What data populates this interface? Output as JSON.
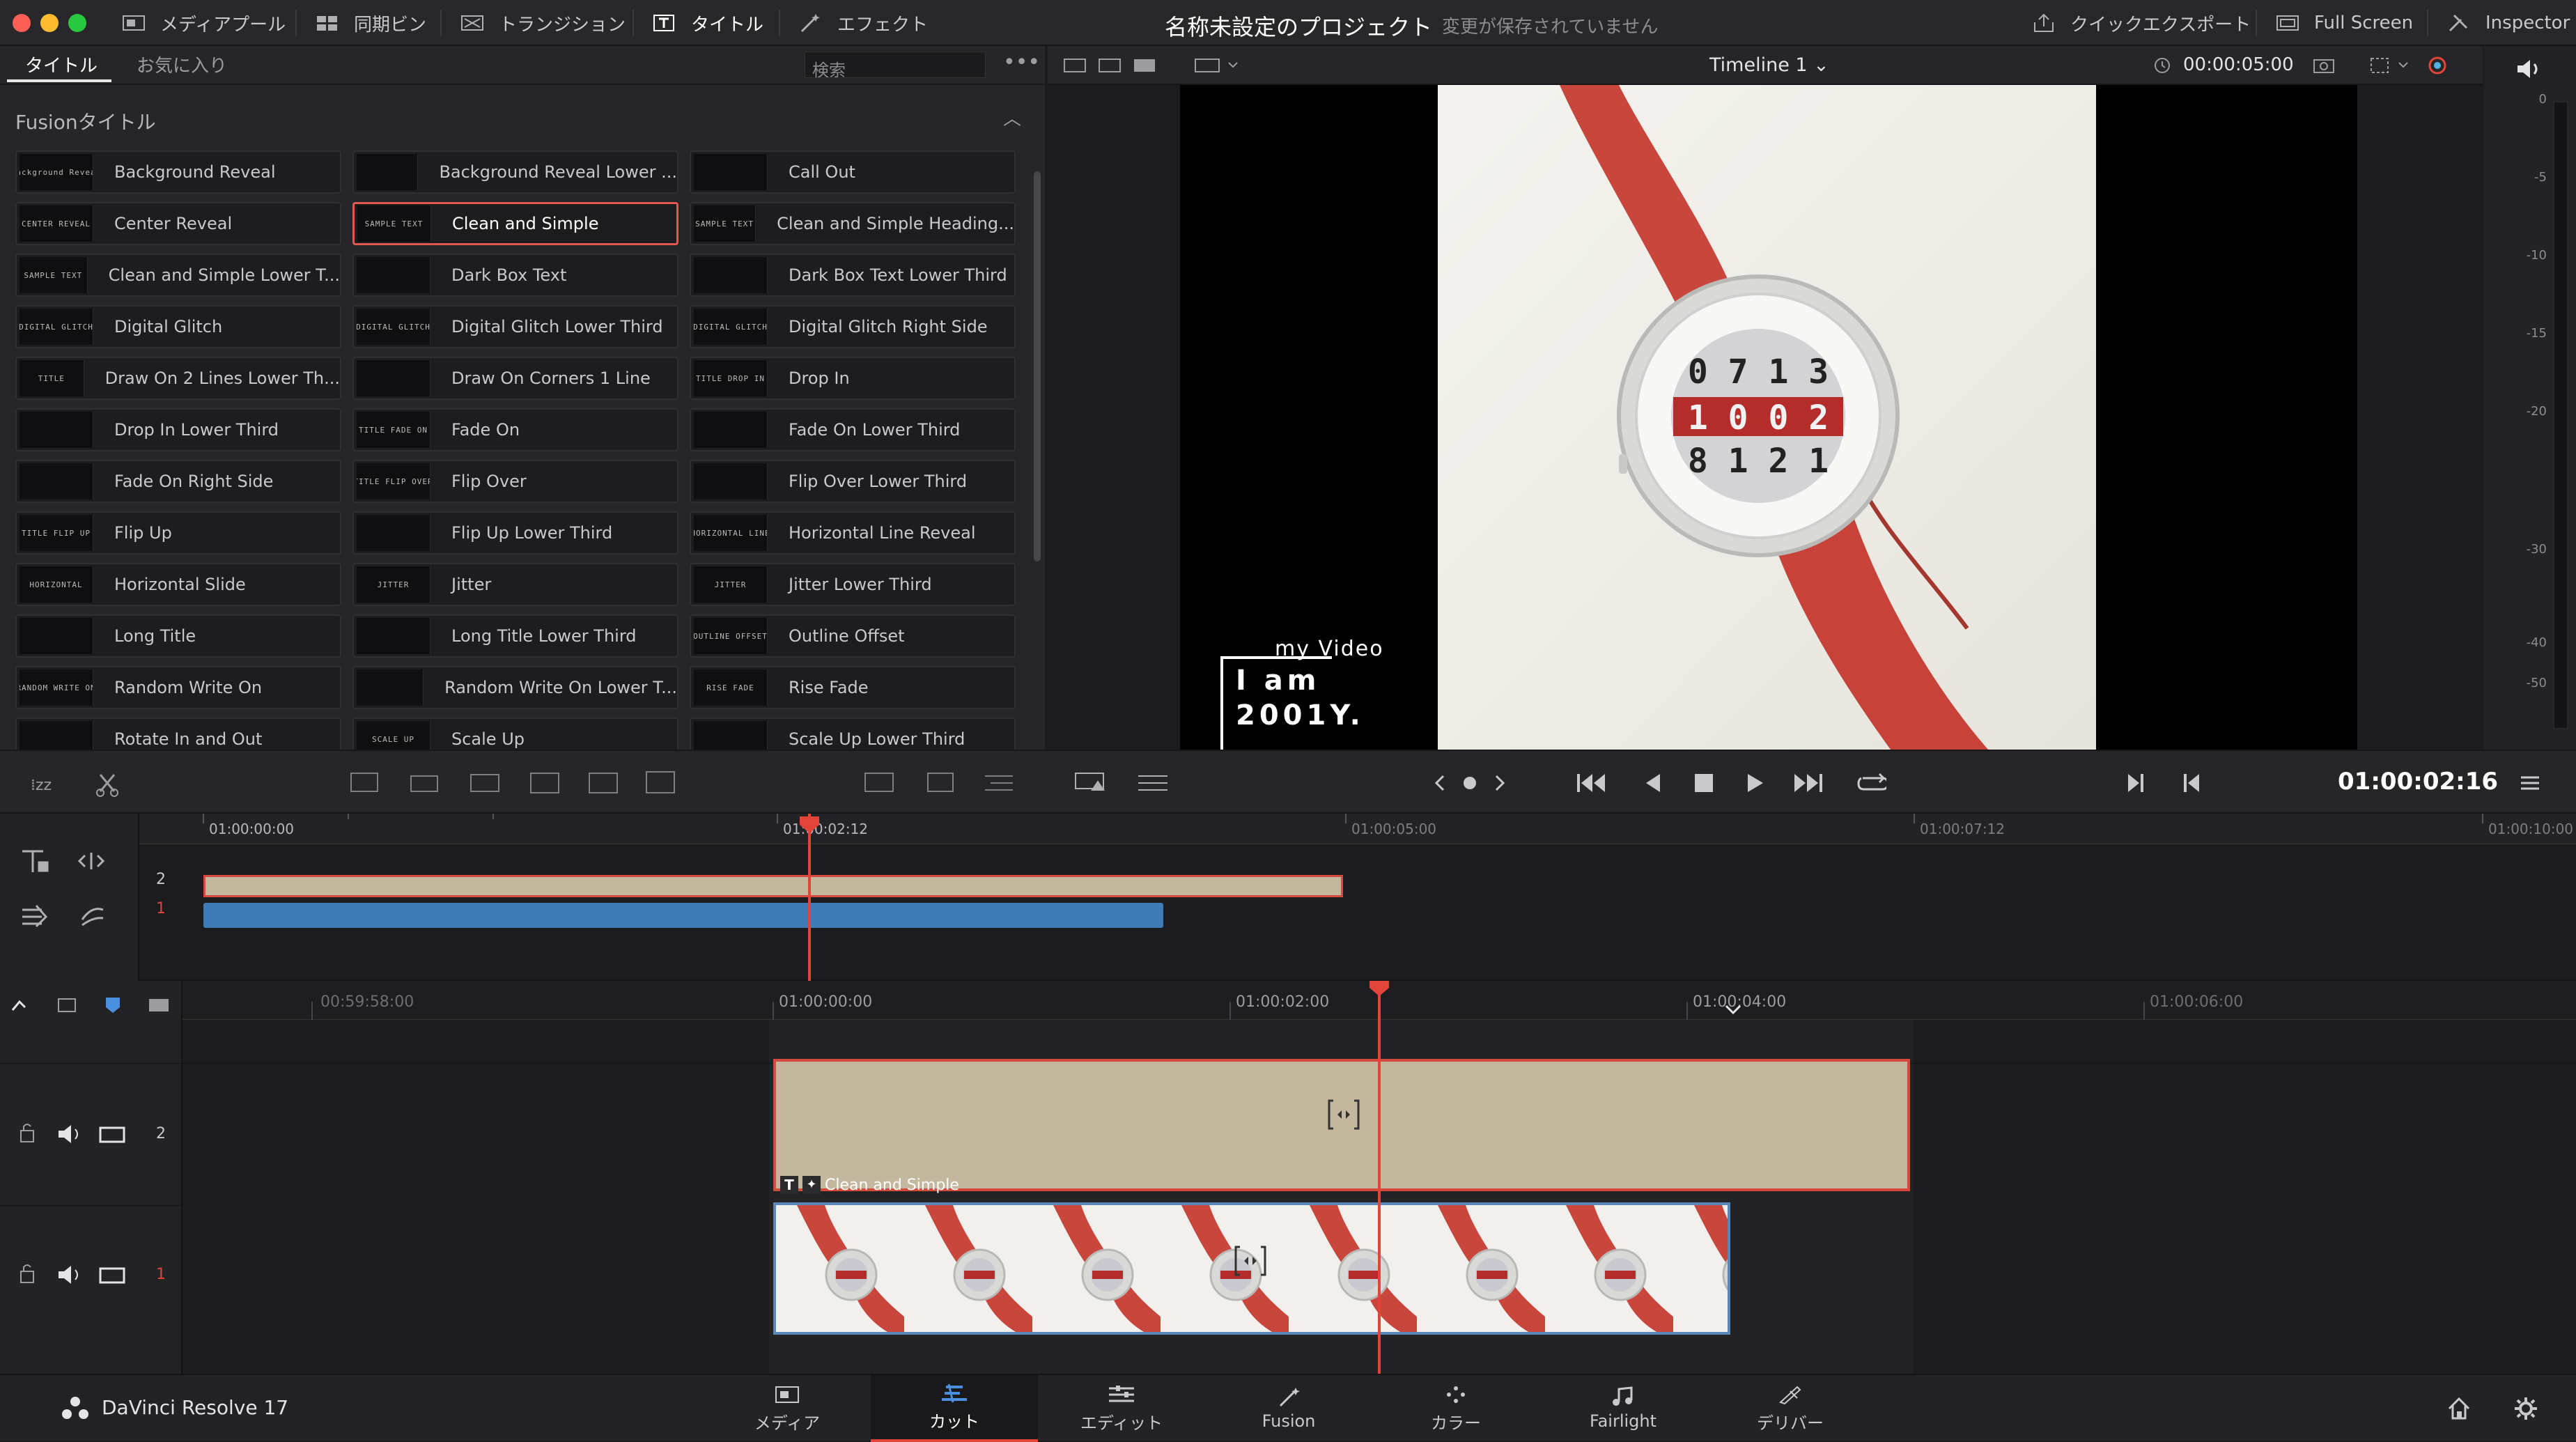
{
  "window": {
    "project_title": "名称未設定のプロジェクト",
    "save_status": "変更が保存されていません"
  },
  "toolbar": {
    "media_pool": "メディアプール",
    "sync_bin": "同期ビン",
    "transitions": "トランジション",
    "titles": "タイトル",
    "effects": "エフェクト",
    "quick_export": "クイックエクスポート",
    "full_screen": "Full Screen",
    "inspector": "Inspector"
  },
  "left_panel": {
    "tab_titles": "タイトル",
    "tab_favorites": "お気に入り",
    "search_placeholder": "検索",
    "section_header": "Fusionタイトル",
    "titles": [
      {
        "label": "Background Reveal",
        "thumb": "Background Reveal"
      },
      {
        "label": "Background Reveal Lower ...",
        "thumb": ""
      },
      {
        "label": "Call Out",
        "thumb": ""
      },
      {
        "label": "Center Reveal",
        "thumb": "CENTER REVEAL"
      },
      {
        "label": "Clean and Simple",
        "thumb": "SAMPLE TEXT",
        "selected": true
      },
      {
        "label": "Clean and Simple Heading...",
        "thumb": "SAMPLE TEXT"
      },
      {
        "label": "Clean and Simple Lower T...",
        "thumb": "SAMPLE TEXT"
      },
      {
        "label": "Dark Box Text",
        "thumb": ""
      },
      {
        "label": "Dark Box Text Lower Third",
        "thumb": ""
      },
      {
        "label": "Digital Glitch",
        "thumb": "DIGITAL GLITCH"
      },
      {
        "label": "Digital Glitch Lower Third",
        "thumb": "DIGITAL GLITCH"
      },
      {
        "label": "Digital Glitch Right Side",
        "thumb": "DIGITAL GLITCH"
      },
      {
        "label": "Draw On 2 Lines Lower Th...",
        "thumb": "TITLE"
      },
      {
        "label": "Draw On Corners 1 Line",
        "thumb": ""
      },
      {
        "label": "Drop In",
        "thumb": "TITLE DROP IN"
      },
      {
        "label": "Drop In Lower Third",
        "thumb": ""
      },
      {
        "label": "Fade On",
        "thumb": "TITLE FADE ON"
      },
      {
        "label": "Fade On Lower Third",
        "thumb": ""
      },
      {
        "label": "Fade On Right Side",
        "thumb": ""
      },
      {
        "label": "Flip Over",
        "thumb": "TITLE FLIP OVER"
      },
      {
        "label": "Flip Over Lower Third",
        "thumb": ""
      },
      {
        "label": "Flip Up",
        "thumb": "TITLE FLIP UP"
      },
      {
        "label": "Flip Up Lower Third",
        "thumb": ""
      },
      {
        "label": "Horizontal Line Reveal",
        "thumb": "HORIZONTAL LINE"
      },
      {
        "label": "Horizontal Slide",
        "thumb": "HORIZONTAL"
      },
      {
        "label": "Jitter",
        "thumb": "JITTER"
      },
      {
        "label": "Jitter Lower Third",
        "thumb": "JITTER"
      },
      {
        "label": "Long Title",
        "thumb": ""
      },
      {
        "label": "Long Title Lower Third",
        "thumb": ""
      },
      {
        "label": "Outline Offset",
        "thumb": "OUTLINE OFFSET"
      },
      {
        "label": "Random Write On",
        "thumb": "RANDOM WRITE ON"
      },
      {
        "label": "Random Write On Lower T...",
        "thumb": ""
      },
      {
        "label": "Rise Fade",
        "thumb": "RISE FADE"
      },
      {
        "label": "Rotate In and Out",
        "thumb": ""
      },
      {
        "label": "Scale Up",
        "thumb": "SCALE UP"
      },
      {
        "label": "Scale Up Lower Third",
        "thumb": ""
      }
    ]
  },
  "viewer": {
    "timeline_name": "Timeline 1",
    "duration": "00:00:05:00",
    "overlay_sub": "my Video",
    "overlay_line1": "I am",
    "overlay_line2": "2001Y.",
    "watch_digits": [
      "0 7 1 3",
      "1 0 0 2",
      "8 1 2 1"
    ]
  },
  "audio_meter": {
    "ticks": [
      "0",
      "-5",
      "-10",
      "-15",
      "-20",
      "-30",
      "-40",
      "-50"
    ]
  },
  "transport": {
    "current_timecode": "01:00:02:16"
  },
  "upper_timeline": {
    "ruler": [
      "01:00:00:00",
      "01:00:02:12",
      "01:00:05:00",
      "01:00:07:12",
      "01:00:10:00"
    ],
    "tracks": [
      "2",
      "1"
    ]
  },
  "lower_timeline": {
    "ruler": [
      "00:59:58:00",
      "01:00:00:00",
      "01:00:02:00",
      "01:00:04:00",
      "01:00:06:00"
    ],
    "tracks": [
      "2",
      "1"
    ],
    "title_clip_label": "Clean and Simple"
  },
  "bottom_nav": {
    "app_name": "DaVinci Resolve 17",
    "pages": [
      "メディア",
      "カット",
      "エディット",
      "Fusion",
      "カラー",
      "Fairlight",
      "デリバー"
    ],
    "active_page": "カット"
  },
  "colors": {
    "accent_red": "#e2443a",
    "title_clip": "#c3b79e",
    "video_clip_border": "#5b86b8",
    "upper_audio_clip": "#3f7bb4"
  }
}
